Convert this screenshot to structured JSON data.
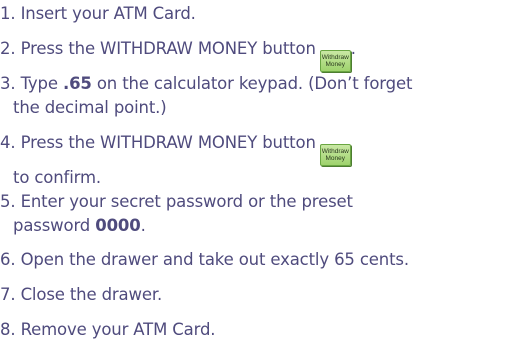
{
  "steps": [
    {
      "num": "1.",
      "text": "Insert your ATM Card."
    },
    {
      "num": "2.",
      "text": "Press the WITHDRAW MONEY button",
      "trailing": "."
    },
    {
      "num": "3.",
      "pre": "Type ",
      "bold": ".65",
      "post": " on the calculator keypad.  (Don’t forget",
      "line2": "the decimal point.)"
    },
    {
      "num": "4.",
      "text": "Press the WITHDRAW MONEY button",
      "line2": "to confirm."
    },
    {
      "num": "5.",
      "text": "Enter your secret password or the preset",
      "line2_pre": "password ",
      "line2_bold": "0000",
      "line2_post": "."
    },
    {
      "num": "6.",
      "text": "Open the drawer and take out exactly 65 cents."
    },
    {
      "num": "7.",
      "text": "Close the drawer."
    },
    {
      "num": "8.",
      "text": "Remove your ATM Card."
    }
  ],
  "withdraw_button": {
    "line1": "Withdraw",
    "line2": "Money"
  },
  "colors": {
    "text": "#4f4b7d",
    "button_fill": "#b4de88",
    "button_border": "#6aa642"
  }
}
